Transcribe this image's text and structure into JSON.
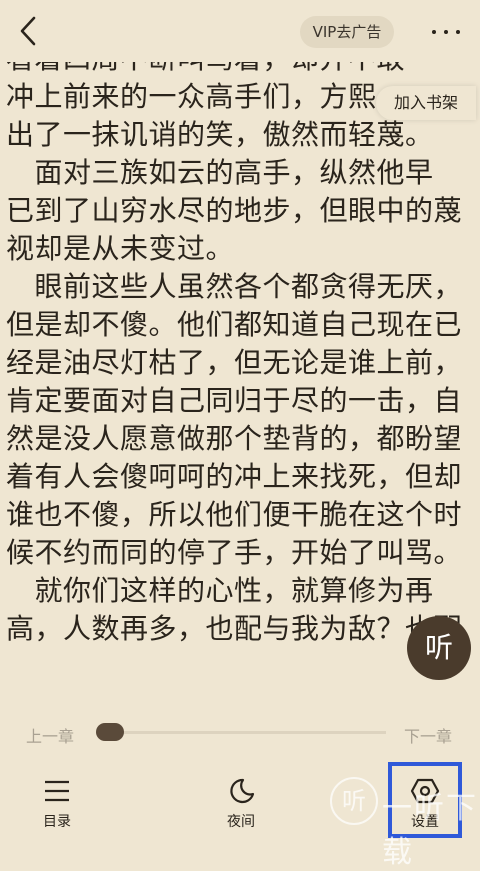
{
  "topbar": {
    "vip_label": "VIP去广告"
  },
  "floating": {
    "add_shelf_label": "加入书架",
    "listen_label": "听"
  },
  "content": {
    "paragraphs": [
      [
        "看着四周不断叫骂着，却并不敢",
        "冲上前来的一众高手们，方熙",
        "出了一抹讥诮的笑，傲然而轻蔑。"
      ],
      [
        "　面对三族如云的高手，纵然他早",
        "已到了山穷水尽的地步，但眼中的蔑",
        "视却是从未变过。"
      ],
      [
        "　眼前这些人虽然各个都贪得无厌，",
        "但是却不傻。他们都知道自己现在已",
        "经是油尽灯枯了，但无论是谁上前，",
        "肯定要面对自己同归于尽的一击，自",
        "然是没人愿意做那个垫背的，都盼望",
        "着有人会傻呵呵的冲上来找死，但却",
        "谁也不傻，所以他们便干脆在这个时",
        "候不约而同的停了手，开始了叫骂。"
      ],
      [
        "　就你们这样的心性，就算修为再",
        "高，人数再多，也配与我为敌？也配"
      ]
    ]
  },
  "chapter_nav": {
    "prev_label": "上一章",
    "next_label": "下一章",
    "progress": 0.0
  },
  "bottom_nav": {
    "catalog_label": "目录",
    "night_label": "夜间",
    "settings_label": "设置"
  },
  "watermark": {
    "logo": "听",
    "text": "一听下载"
  },
  "colors": {
    "background": "#efe6d2",
    "highlight_border": "#2f59d9",
    "listen_button": "#4a3b2c"
  }
}
